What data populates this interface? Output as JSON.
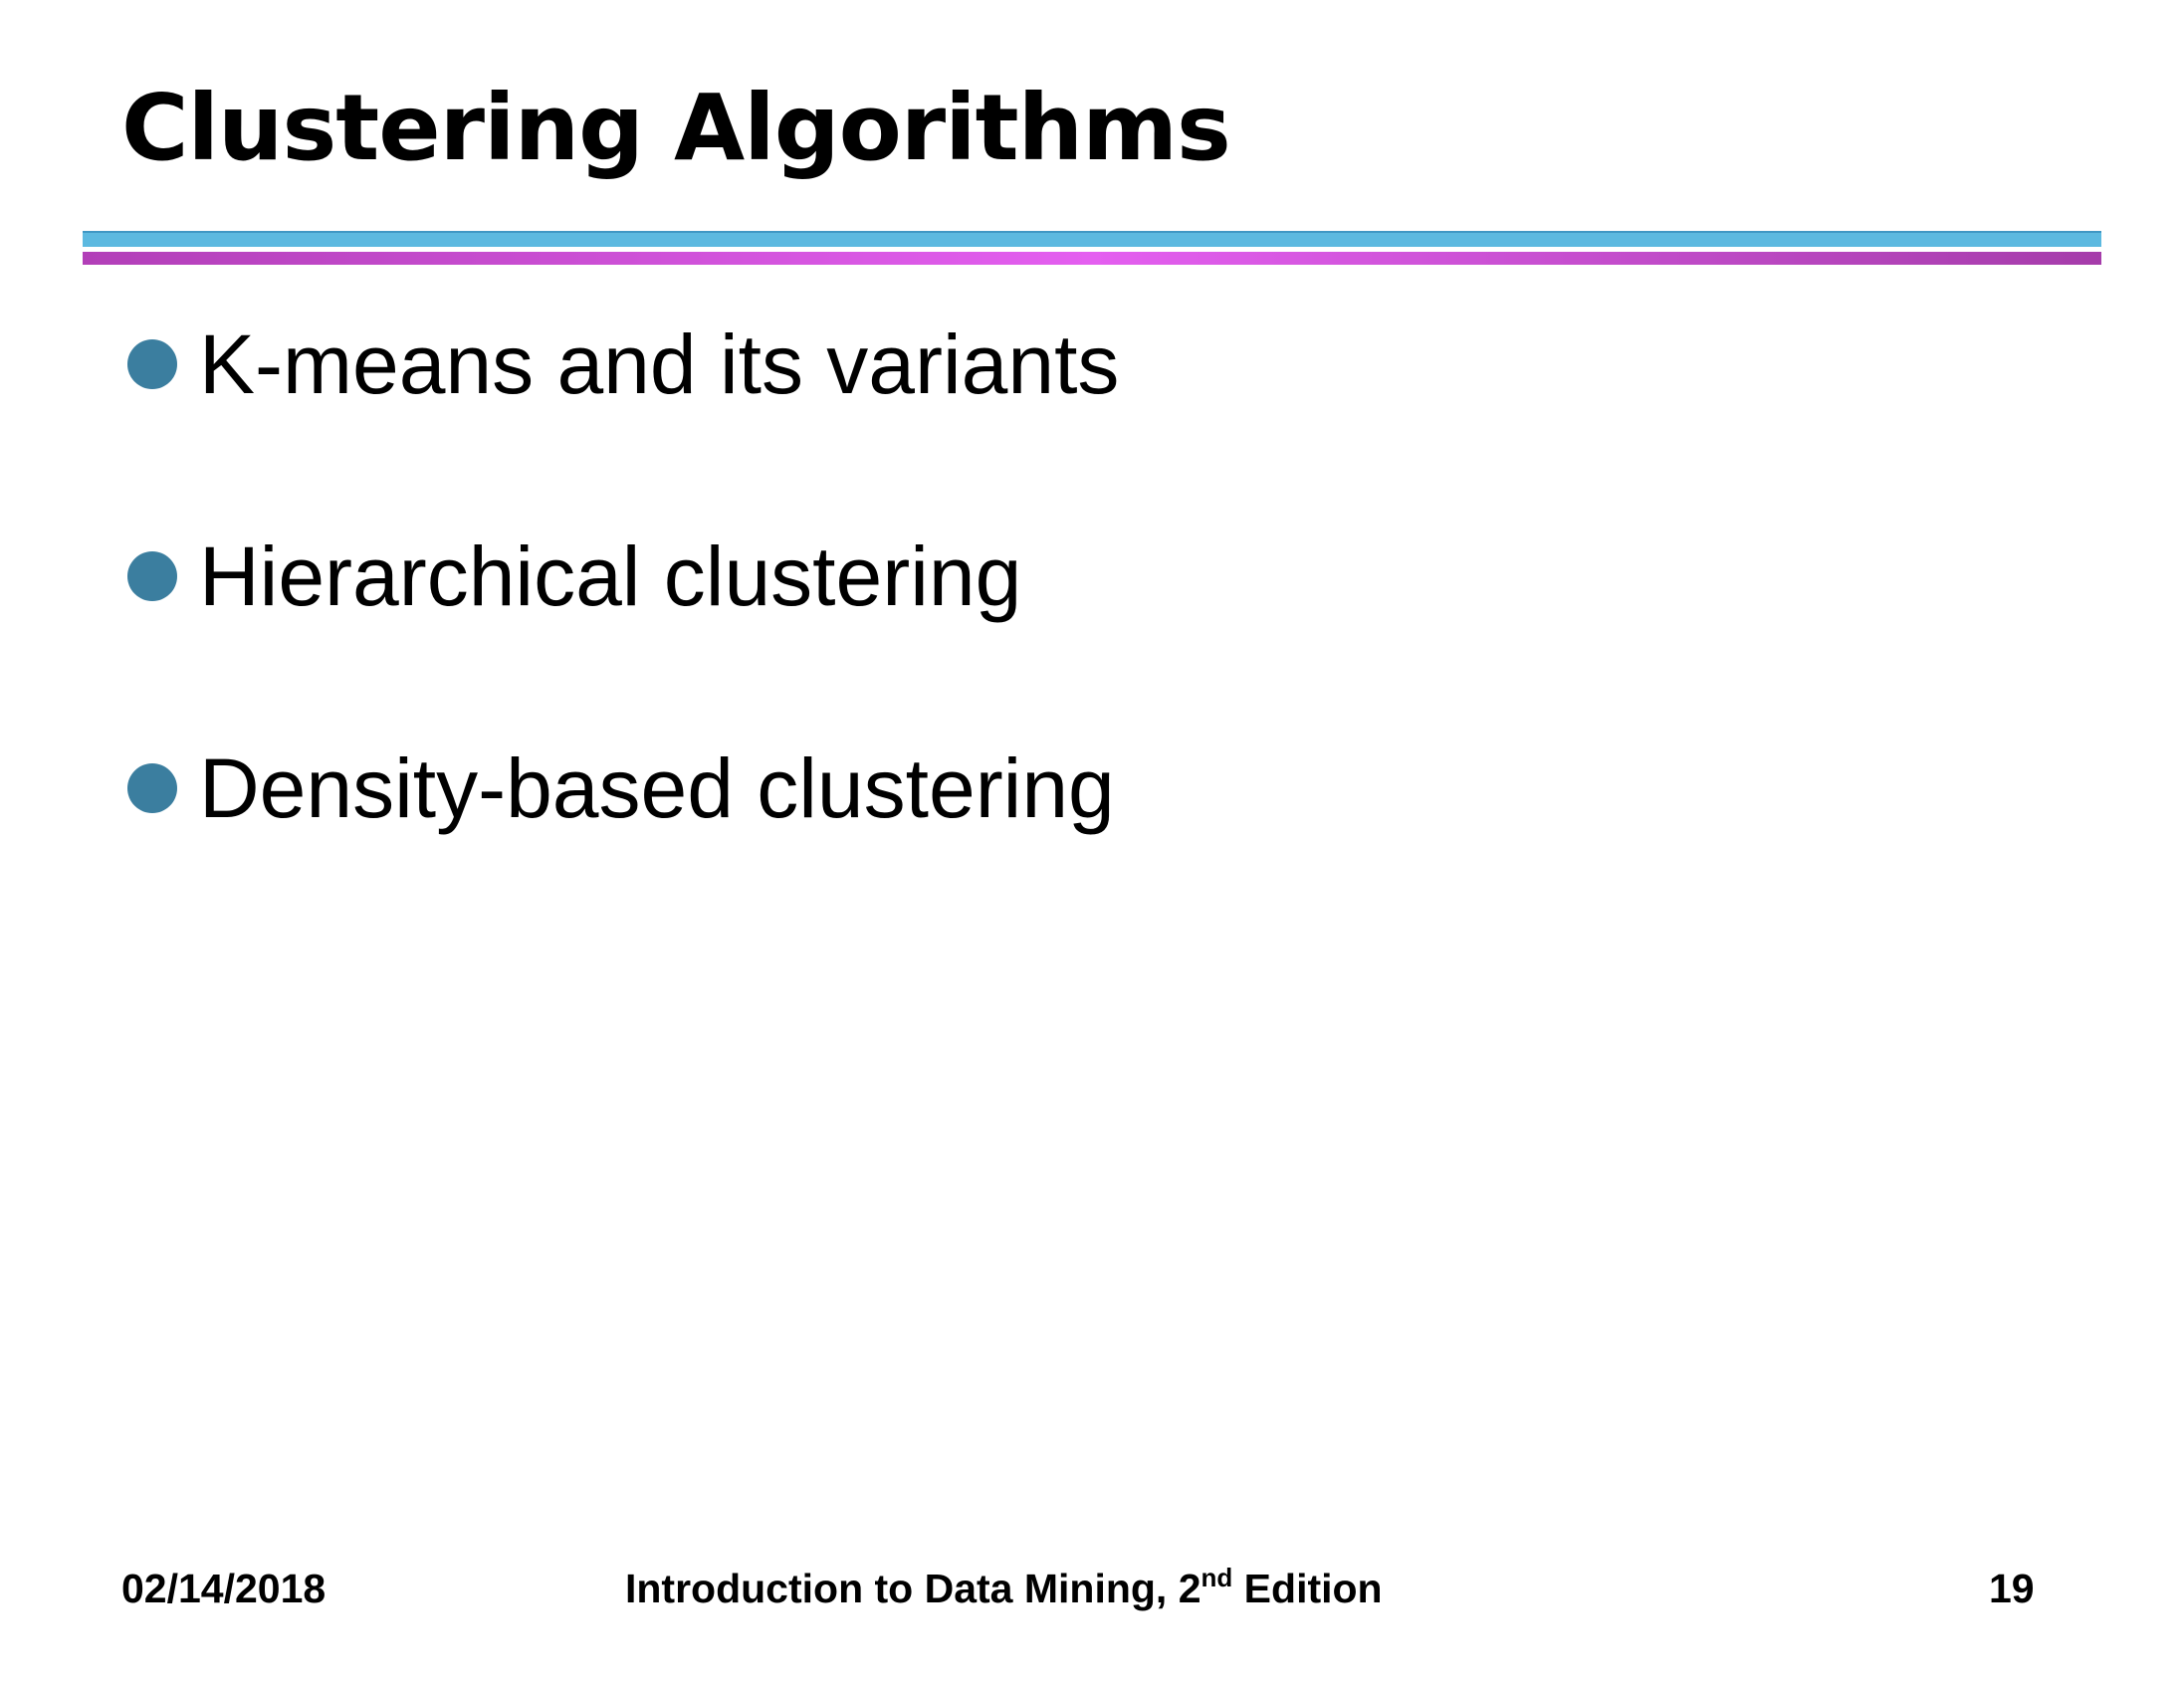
{
  "slide": {
    "title": "Clustering Algorithms",
    "bullets": [
      "K-means and its variants",
      "Hierarchical clustering",
      "Density-based clustering"
    ],
    "footer": {
      "date": "02/14/2018",
      "course_prefix": "Introduction to Data Mining, 2",
      "course_superscript": "nd",
      "course_suffix": " Edition",
      "page_number": "19"
    },
    "colors": {
      "bullet": "#3b7e9f",
      "rule_top": "#5cb9e0",
      "rule_bottom": "#e45ff0"
    }
  }
}
